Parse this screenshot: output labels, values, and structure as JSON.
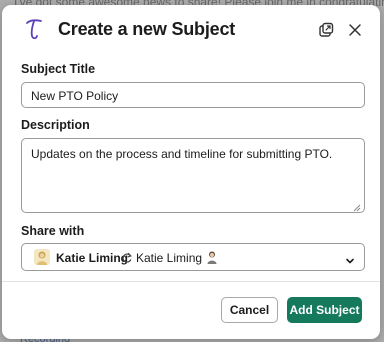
{
  "background": {
    "top_text": "I've got some awesome news to share! Please join me in congratulating you",
    "bottom_text": "Recording"
  },
  "modal": {
    "title": "Create a new Subject",
    "icons": {
      "logo": "script-t-logo-icon",
      "popout": "popout-window-icon",
      "close": "close-icon"
    },
    "subject_title": {
      "label": "Subject Title",
      "value": "New PTO Policy"
    },
    "description": {
      "label": "Description",
      "value": "Updates on the process and timeline for submitting PTO."
    },
    "share_with": {
      "label": "Share with",
      "selected_name": "Katie Liming",
      "secondary_name": "Katie Liming",
      "icons": [
        "avatar",
        "sync-icon",
        "avatar",
        "chevron-down-icon"
      ]
    },
    "buttons": {
      "cancel": "Cancel",
      "add": "Add Subject"
    }
  },
  "colors": {
    "accent": "#157a5b",
    "logo": "#5b3fb8"
  }
}
